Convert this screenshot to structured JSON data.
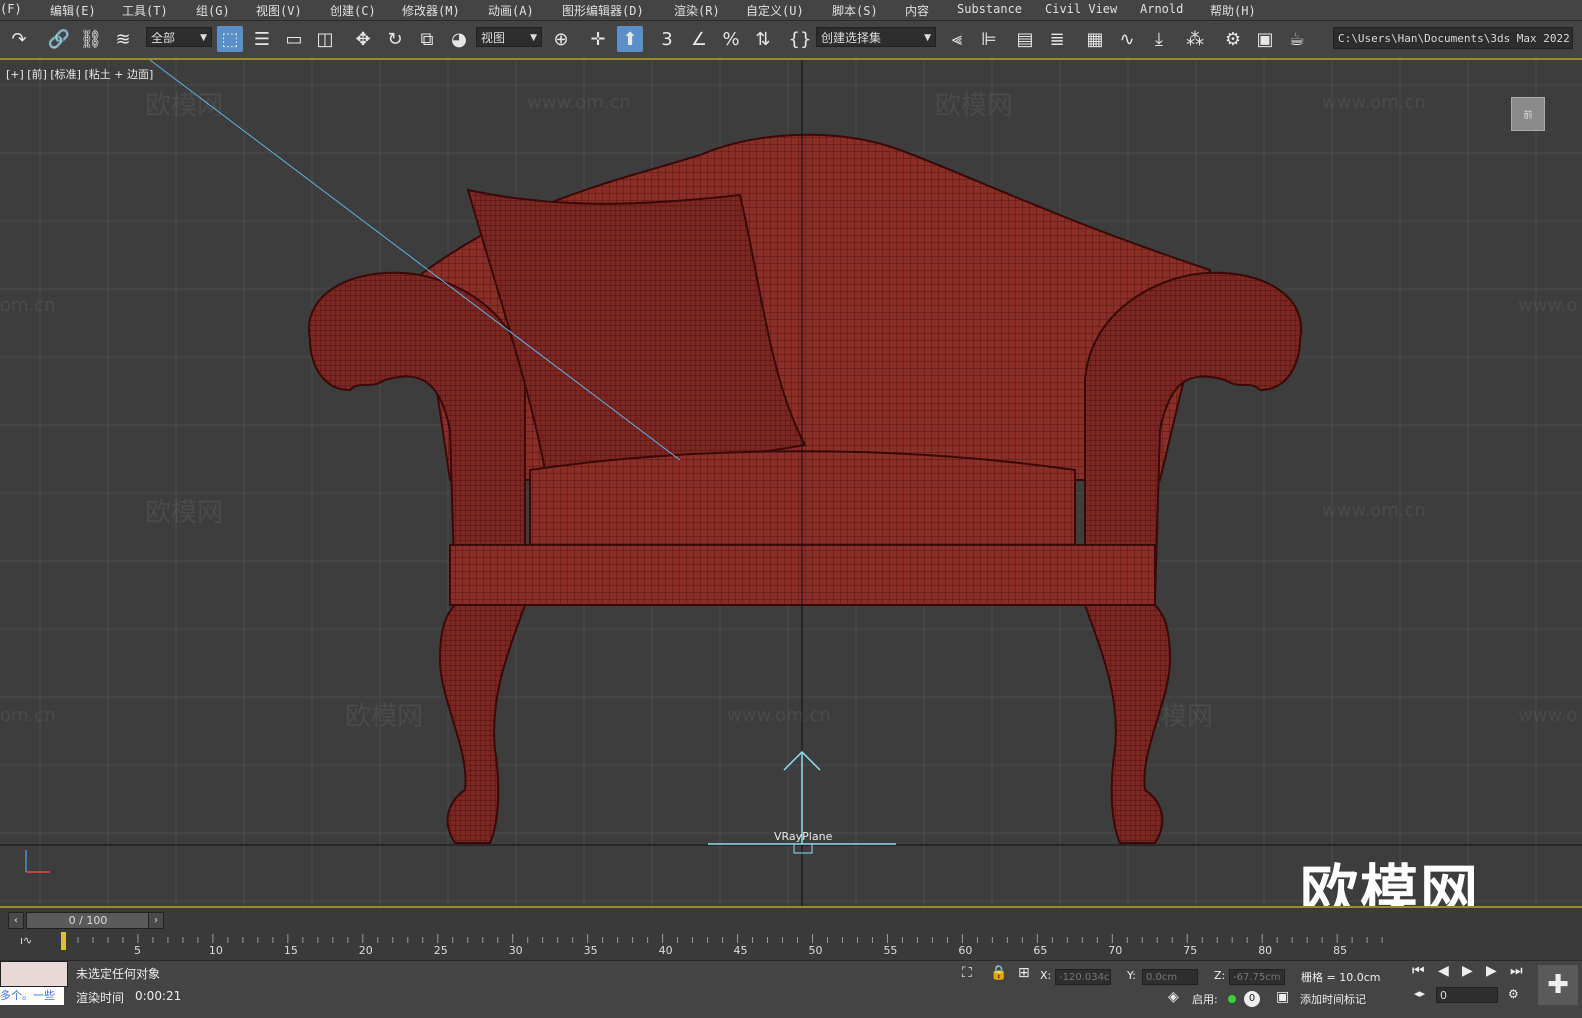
{
  "menu": [
    "(F)",
    "编辑(E)",
    "工具(T)",
    "组(G)",
    "视图(V)",
    "创建(C)",
    "修改器(M)",
    "动画(A)",
    "图形编辑器(D)",
    "渲染(R)",
    "自定义(U)",
    "脚本(S)",
    "内容",
    "Substance",
    "Civil View",
    "Arnold",
    "帮助(H)"
  ],
  "toolbar": {
    "filter_dropdown": "全部",
    "view_dropdown": "视图",
    "snap_label": "3",
    "selection_set": "创建选择集",
    "path": "C:\\Users\\Han\\Documents\\3ds Max 2022"
  },
  "viewport": {
    "label": "[+] [前] [标准] [粘土 + 边面]",
    "object_label": "VRayPlane",
    "viewcube_label": "前",
    "logo": "欧模网",
    "watermark_text": "欧模网",
    "watermark_url": "www.om.cn",
    "watermark_url_partial": "om.cn",
    "watermark_url_cut": "www.o"
  },
  "timeline": {
    "frame_display": "0 / 100",
    "ticks": [
      "5",
      "10",
      "15",
      "20",
      "25",
      "30",
      "35",
      "40",
      "45",
      "50",
      "55",
      "60",
      "65",
      "70",
      "75",
      "80",
      "85"
    ]
  },
  "status": {
    "selection": "未选定任何对象",
    "render_time_label": "渲染时间",
    "render_time": "0:00:21",
    "script_text": "多个。一些",
    "x_label": "X:",
    "x_value": "-120.034c",
    "y_label": "Y:",
    "y_value": "0.0cm",
    "z_label": "Z:",
    "z_value": "-67.75cm",
    "grid": "栅格 = 10.0cm",
    "enable_label": "启用:",
    "enable_value": "0",
    "add_time_tag": "添加时间标记",
    "current_frame": "0"
  },
  "colors": {
    "model_fill": "#8a2e28",
    "model_wire": "#4a0f0c",
    "grid_line": "#4a4a4a",
    "accent_blue": "#5b8fc7",
    "highlight_border": "#9a8a2a"
  }
}
